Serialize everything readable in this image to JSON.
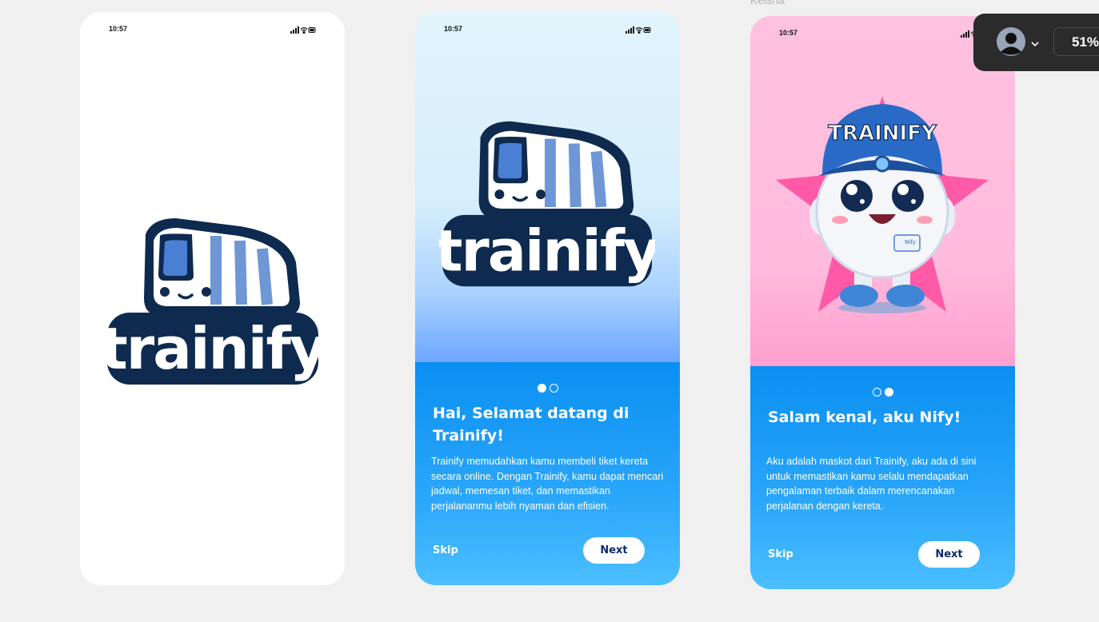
{
  "canvas": {
    "frame_label": "Keisha"
  },
  "status_bar": {
    "time_phone1": "10:57",
    "time_phone2": "10:57",
    "time_phone3": "10:57"
  },
  "logo": {
    "text": "trainify"
  },
  "onboarding_1": {
    "title": "Hai, Selamat datang di Trainify!",
    "body": "Trainify memudahkan kamu membeli tiket kereta secara online.  Dengan Trainify, kamu dapat mencari jadwal, memesan tiket, dan memastikan perjalananmu lebih nyaman dan efisien.",
    "skip_label": "Skip",
    "next_label": "Next",
    "page_index": 1,
    "page_count": 2
  },
  "onboarding_2": {
    "mascot_cap_text": "TRAINIFY",
    "mascot_badge_text": "Nify",
    "title": "Salam kenal, aku Nify!",
    "body": "Aku adalah maskot dari Trainify, aku ada di sini untuk memastikan kamu selalu mendapatkan pengalaman terbaik dalam merencanakan perjalanan dengan kereta.",
    "skip_label": "Skip",
    "next_label": "Next",
    "page_index": 2,
    "page_count": 2
  },
  "zoom_popover": {
    "zoom_value": "51%"
  },
  "colors": {
    "panel_blue": "#0a8ff2",
    "logo_navy": "#0f2a4f",
    "logo_blue": "#3b6fd6",
    "pink_bg": "#ffc1e0",
    "star_pink": "#ff5aa8"
  },
  "icons": {
    "status": [
      "signal-icon",
      "wifi-icon",
      "battery-icon"
    ],
    "popover": [
      "user-avatar-icon",
      "chevron-down-icon"
    ]
  }
}
